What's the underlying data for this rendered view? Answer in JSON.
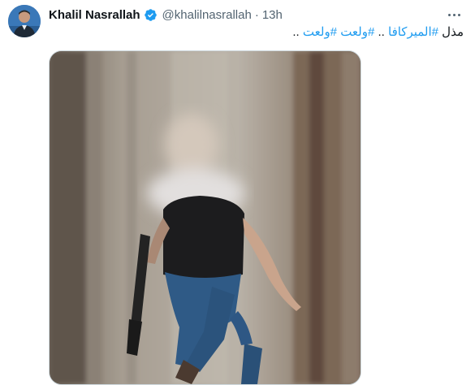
{
  "tweet": {
    "author_name": "Khalil Nasrallah",
    "handle": "@khalilnasrallah",
    "separator": "·",
    "time": "13h",
    "text_prefix": "مذل ",
    "hashtag_1": "#الميركافا",
    "text_mid": " .. ",
    "hashtag_2": "#ولعت",
    "space": " ",
    "hashtag_3": "#ولعت",
    "text_suffix": " .."
  },
  "icons": {
    "verified": "verified-badge-icon",
    "more": "more-options-icon"
  },
  "colors": {
    "accent": "#1d9bf0",
    "secondary_text": "#536471",
    "primary_text": "#0f1419"
  }
}
